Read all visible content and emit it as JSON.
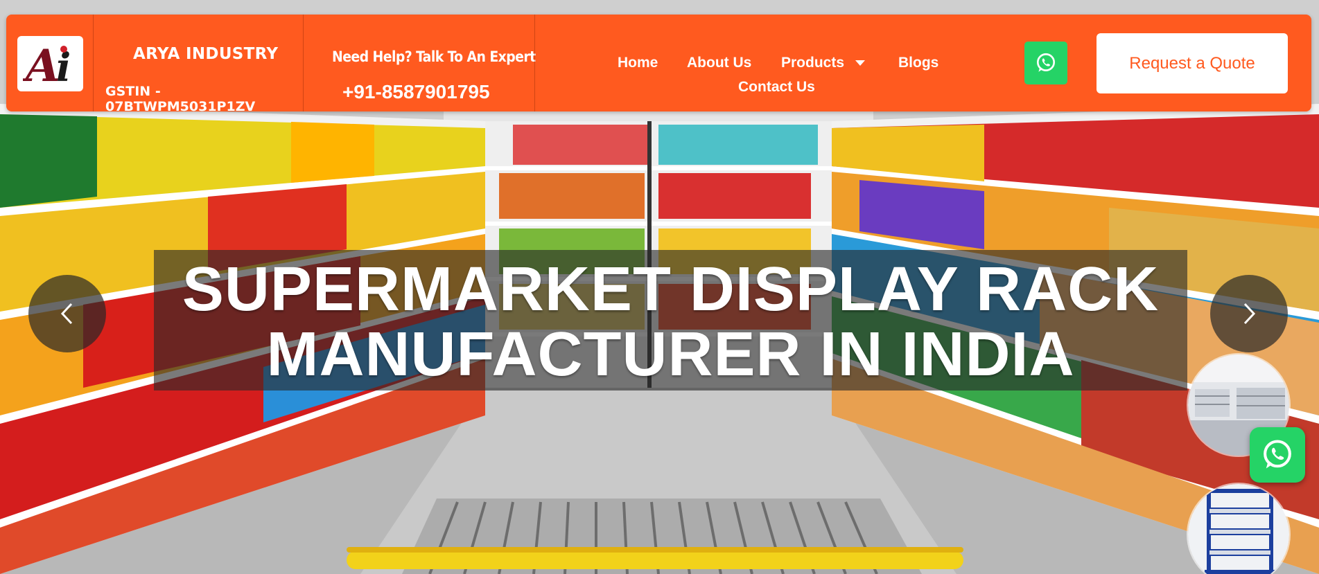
{
  "header": {
    "brand_name": "ARYA INDUSTRY",
    "gstin": "GSTIN - 07BTWPM5031P1ZV",
    "help_text": "Need Help? Talk To An Expert",
    "phone": "+91-8587901795",
    "logo_text": "Ai",
    "quote_button": "Request a Quote"
  },
  "nav": {
    "home": "Home",
    "about": "About Us",
    "products": "Products",
    "blogs": "Blogs",
    "contact": "Contact Us"
  },
  "hero": {
    "title_line1": "SUPERMARKET DISPLAY RACK",
    "title_line2": "MANUFACTURER IN INDIA"
  },
  "icons": {
    "whatsapp": "whatsapp-icon",
    "prev": "chevron-left-icon",
    "next": "chevron-right-icon",
    "dropdown": "caret-down-icon"
  },
  "colors": {
    "accent": "#ff5a1f",
    "whatsapp": "#25d366",
    "overlay": "#282828"
  }
}
